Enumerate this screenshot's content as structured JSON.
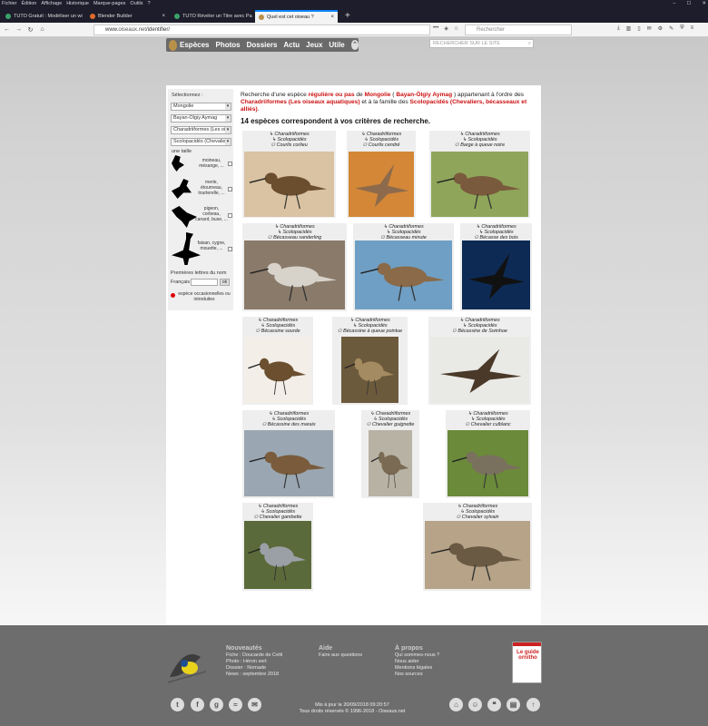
{
  "os_menu": [
    "Fichier",
    "Édition",
    "Affichage",
    "Historique",
    "Marque-pages",
    "Outils",
    "?"
  ],
  "tabs": [
    {
      "title": "TUTO Gratuit : Modéliser un wi",
      "color": "#3aa36b",
      "active": false
    },
    {
      "title": "Blender Builder",
      "color": "#e06b2a",
      "active": false
    },
    {
      "title": "TUTO Révéler un Titre avec Pa",
      "color": "#3aa36b",
      "active": false
    },
    {
      "title": "Quel est cet oiseau ?",
      "color": "#b9904a",
      "active": true
    }
  ],
  "browser": {
    "url_prefix": "www.",
    "url_domain": "oiseaux.net",
    "url_path": "/identifier/",
    "search_placeholder": "Rechercher"
  },
  "site_nav": {
    "items": [
      "Espèces",
      "Photos",
      "Dossiers",
      "Actu",
      "Jeux",
      "Utile"
    ],
    "search_placeholder": "RECHERCHER SUR LE SITE"
  },
  "sidebar": {
    "heading": "Sélectionnez :",
    "selects": [
      "Mongolie",
      "Bayan-Ölgiy Aymag",
      "Charadriiformes (Les oi",
      "Scolopacidés (Chevalie"
    ],
    "size_label": "une taille",
    "sizes": [
      {
        "label": "moineau, mésange, ..."
      },
      {
        "label": "merle, étourneau, tourterelle, ..."
      },
      {
        "label": "pigeon, corbeau, canard, buse, ..."
      },
      {
        "label": "faisan, cygne, mouette, ..."
      }
    ],
    "first_letters_label": "Premières lettres du nom",
    "lang": "Français",
    "ok": "ok",
    "note": "espèce occasionnelles ou introduites"
  },
  "intro": {
    "p1": "Recherche d'une espèce ",
    "status": "régulière ou pas",
    "p2": " de ",
    "country": "Mongolie",
    "p3": " ( ",
    "region": "Bayan-Ölgiy Aymag",
    "p4": " ) appartenant à l'ordre des ",
    "order": "Charadriiformes (Les oiseaux aquatiques)",
    "p5": " et à la famille des ",
    "family": "Scolopacidés (Chevaliers, bécasseaux et alliés)",
    "p6": "."
  },
  "result_count": "14 espèces correspondent à vos critères de recherche.",
  "cards": [
    {
      "order": "Charadriiformes",
      "family": "Scolopacidés",
      "name": "Courlis corlieu",
      "bg": "#d9c3a2",
      "bird": "#6b4e2e"
    },
    {
      "order": "Charadriiformes",
      "family": "Scolopacidés",
      "name": "Courlis cendré",
      "bg": "#d38737",
      "bird": "#8d6a4c"
    },
    {
      "order": "Charadriiformes",
      "family": "Scolopacidés",
      "name": "Barge à queue noire",
      "bg": "#8fa65a",
      "bird": "#7a5a3c"
    },
    {
      "order": "Charadriiformes",
      "family": "Scolopacidés",
      "name": "Bécasseau sanderling",
      "bg": "#8a7a6a",
      "bird": "#d8d3ca"
    },
    {
      "order": "Charadriiformes",
      "family": "Scolopacidés",
      "name": "Bécasseau minute",
      "bg": "#6f9fc4",
      "bird": "#8a6a48"
    },
    {
      "order": "Charadriiformes",
      "family": "Scolopacidés",
      "name": "Bécasse des bois",
      "bg": "#0d2a55",
      "bird": "#111"
    },
    {
      "order": "Charadriiformes",
      "family": "Scolopacidés",
      "name": "Bécassine sourde",
      "bg": "#f3efe8",
      "bird": "#6b4f2f"
    },
    {
      "order": "Charadriiformes",
      "family": "Scolopacidés",
      "name": "Bécassine à queue pointue",
      "bg": "#6c5a3c",
      "bird": "#a58b61"
    },
    {
      "order": "Charadriiformes",
      "family": "Scolopacidés",
      "name": "Bécassine de Swinhoe",
      "bg": "#e9e9e6",
      "bird": "#4a3928"
    },
    {
      "order": "Charadriiformes",
      "family": "Scolopacidés",
      "name": "Bécassine des marais",
      "bg": "#9aa7b2",
      "bird": "#7a5c3c"
    },
    {
      "order": "Charadriiformes",
      "family": "Scolopacidés",
      "name": "Chevalier guignette",
      "bg": "#b8b2a4",
      "bird": "#7a6a54"
    },
    {
      "order": "Charadriiformes",
      "family": "Scolopacidés",
      "name": "Chevalier culblanc",
      "bg": "#6b8a3a",
      "bird": "#7a705e"
    },
    {
      "order": "Charadriiformes",
      "family": "Scolopacidés",
      "name": "Chevalier gambette",
      "bg": "#5a6a3a",
      "bird": "#9aa0a6"
    },
    {
      "order": "Charadriiformes",
      "family": "Scolopacidés",
      "name": "Chevalier sylvain",
      "bg": "#b6a388",
      "bird": "#6a5a44"
    }
  ],
  "footer": {
    "news_title": "Nouveautés",
    "news": [
      "Fiche : Doucarde de Cetti",
      "Photo : Héron vert",
      "Dossier : Nomade",
      "News : septembre 2018"
    ],
    "help_title": "Aide",
    "help": [
      "Faire aux questions"
    ],
    "about_title": "À propos",
    "about": [
      "Qui sommes-nous ?",
      "Nous aider",
      "Mentions légales",
      "Nos sources"
    ],
    "updated": "Mis à jour le 20/09/2018 09:20:57",
    "rights": "Tous droits réservés © 1996-2018 - Oiseaux.net",
    "book_title": "Le guide ornitho"
  }
}
